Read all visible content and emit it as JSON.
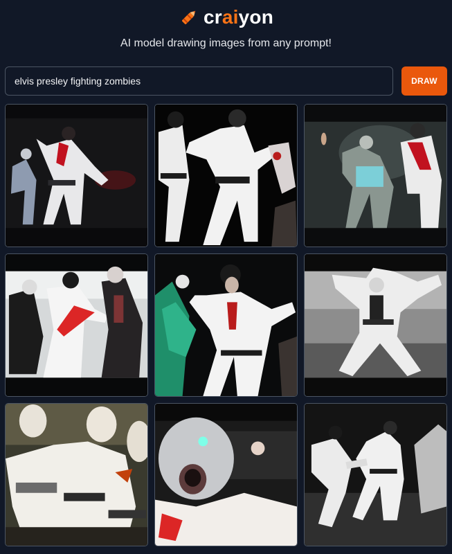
{
  "header": {
    "logo_prefix": "cr",
    "logo_accent": "ai",
    "logo_suffix": "yon",
    "tagline": "AI model drawing images from any prompt!"
  },
  "search": {
    "value": "elvis presley fighting zombies"
  },
  "draw_button": {
    "label": "DRAW"
  },
  "colors": {
    "background": "#111827",
    "accent": "#ea580c",
    "border": "#4b5563"
  },
  "results": [
    {
      "alt": "generated image 1"
    },
    {
      "alt": "generated image 2"
    },
    {
      "alt": "generated image 3"
    },
    {
      "alt": "generated image 4"
    },
    {
      "alt": "generated image 5"
    },
    {
      "alt": "generated image 6"
    },
    {
      "alt": "generated image 7"
    },
    {
      "alt": "generated image 8"
    },
    {
      "alt": "generated image 9"
    }
  ]
}
